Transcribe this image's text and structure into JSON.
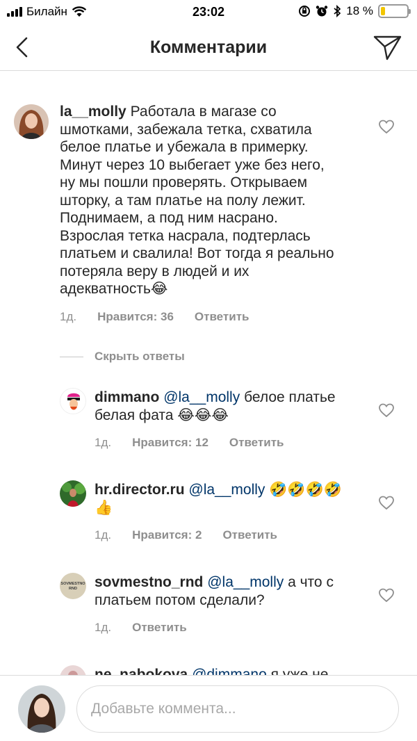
{
  "status_bar": {
    "carrier": "Билайн",
    "time": "23:02",
    "battery_percent": "18 %",
    "battery_level": 0.18
  },
  "header": {
    "title": "Комментарии"
  },
  "comments": [
    {
      "username": "la__molly",
      "text": "Работала в магазе со шмотками, забежала тетка, схватила белое платье и убежала в примерку. Минут через 10 выбегает уже без него, ну мы пошли проверять. Открываем шторку, а там платье на полу лежит. Поднимаем, а под ним насрано. Взрослая тетка насрала, подтерлась платьем и свалила! Вот тогда я реально потеряла веру в людей и их адекватность😂",
      "time": "1д.",
      "likes": "Нравится: 36",
      "reply": "Ответить"
    }
  ],
  "hide_replies": "Скрыть ответы",
  "replies": [
    {
      "username": "dimmano",
      "mention": "@la__molly",
      "text": " белое платье белая фата 😂😂😂",
      "time": "1д.",
      "likes": "Нравится: 12",
      "reply": "Ответить"
    },
    {
      "username": "hr.director.ru",
      "mention": "@la__molly",
      "text": "🤣🤣🤣🤣👍",
      "time": "1д.",
      "likes": "Нравится: 2",
      "reply": "Ответить"
    },
    {
      "username": "sovmestno_rnd",
      "mention": "@la__molly",
      "text": "а что с платьем потом сделали?",
      "time": "1д.",
      "reply": "Ответить"
    },
    {
      "username": "ne_nabokova",
      "mention": "@dimmano",
      "text": "я уже не"
    }
  ],
  "input": {
    "placeholder": "Добавьте коммента..."
  }
}
